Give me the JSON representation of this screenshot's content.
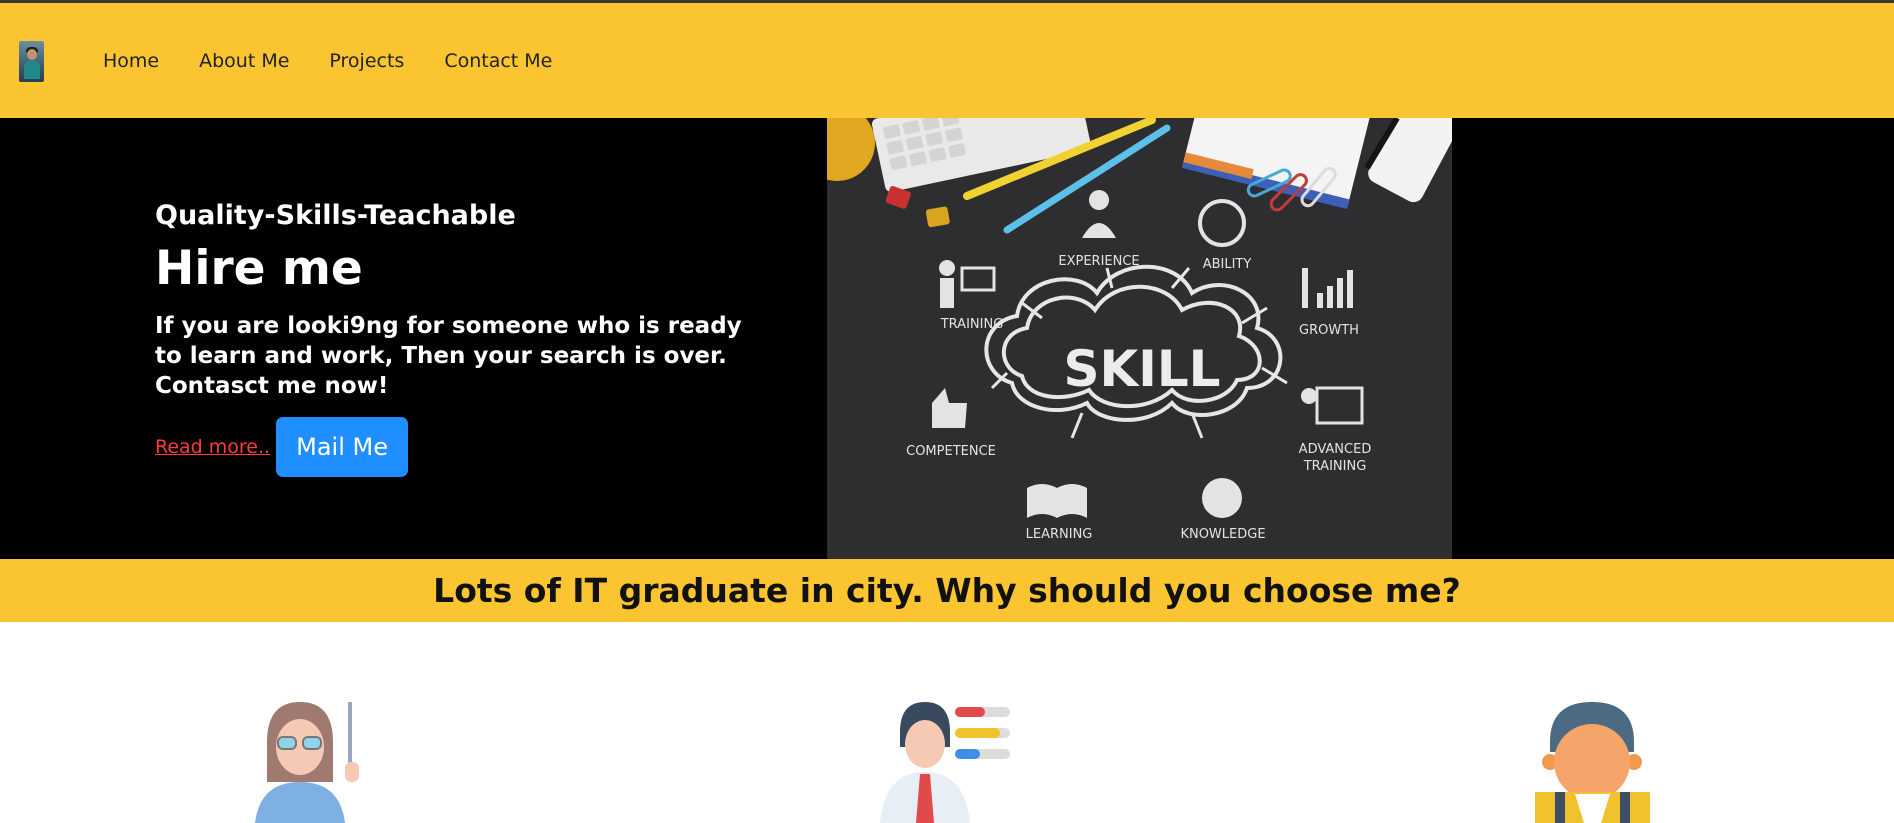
{
  "nav": {
    "logo_alt": "profile avatar",
    "links": [
      "Home",
      "About Me",
      "Projects",
      "Contact Me"
    ]
  },
  "hero": {
    "tagline": "Quality-Skills-Teachable",
    "title": "Hire me",
    "pitch": "If you are looki9ng for someone who is ready to learn and work, Then your search is over. Contasct me now!",
    "read_more": "Read more..",
    "mail_button": "Mail Me",
    "image": {
      "center": "SKILL",
      "labels": [
        "EXPERIENCE",
        "ABILITY",
        "TRAINING",
        "GROWTH",
        "COMPETENCE",
        "ADVANCED",
        "TRAINING",
        "LEARNING",
        "KNOWLEDGE"
      ]
    }
  },
  "why": {
    "title": "Lots of IT graduate in city. Why should you choose me?"
  },
  "features": {
    "icons": [
      "teacher-icon",
      "skills-person-icon",
      "student-icon"
    ]
  },
  "colors": {
    "accent": "#fbc531",
    "hero_bg": "#000000",
    "button": "#1f8fff",
    "link": "#ff3b3b"
  }
}
